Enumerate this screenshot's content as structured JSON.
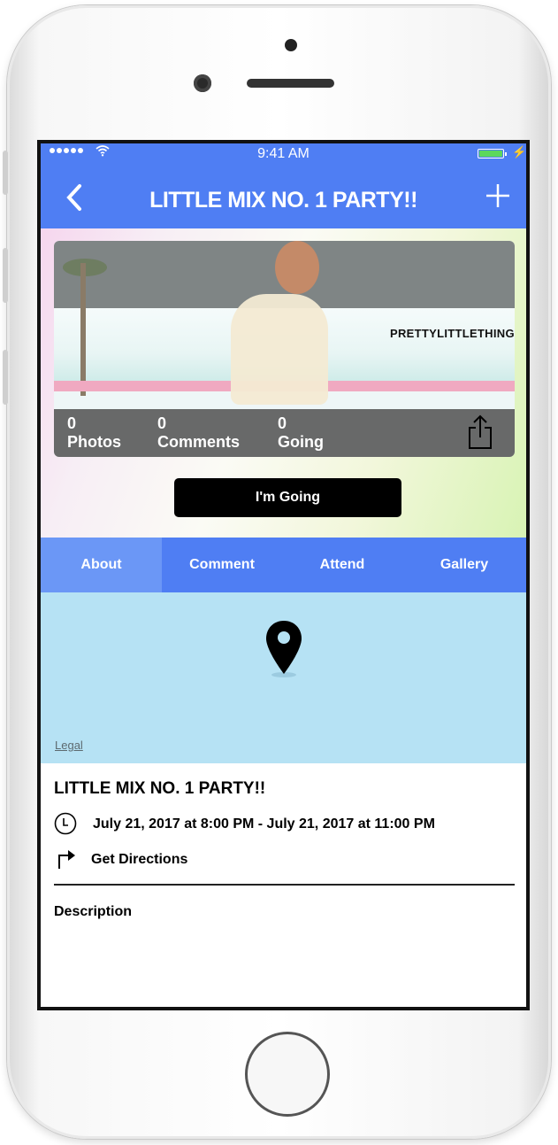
{
  "status_bar": {
    "time": "9:41 AM"
  },
  "nav": {
    "title": "LITTLE MIX NO. 1 PARTY!!"
  },
  "hero": {
    "brand_text": "PRETTYLITTLETHING",
    "stats": [
      {
        "count": "0",
        "label": "Photos"
      },
      {
        "count": "0",
        "label": "Comments"
      },
      {
        "count": "0",
        "label": "Going"
      }
    ]
  },
  "going_button": {
    "label": "I'm Going"
  },
  "tabs": [
    {
      "label": "About",
      "active": true
    },
    {
      "label": "Comment",
      "active": false
    },
    {
      "label": "Attend",
      "active": false
    },
    {
      "label": "Gallery",
      "active": false
    }
  ],
  "map": {
    "legal_label": "Legal"
  },
  "event": {
    "title": "LITTLE MIX NO. 1 PARTY!!",
    "datetime": "July 21, 2017 at 8:00 PM - July 21, 2017 at 11:00 PM",
    "directions_label": "Get Directions",
    "description_heading": "Description"
  },
  "colors": {
    "header_blue": "#4f7ef3",
    "tab_active": "#6b97f6",
    "map_blue": "#b6e2f4",
    "button_black": "#000000"
  },
  "icons": {
    "back": "chevron-left-icon",
    "add": "plus-icon",
    "share": "share-icon",
    "map_pin": "map-pin-icon",
    "clock": "clock-icon",
    "directions": "turn-right-arrow-icon"
  }
}
